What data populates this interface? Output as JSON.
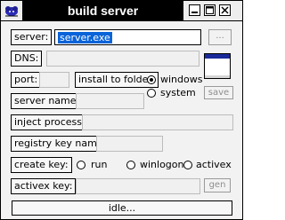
{
  "window": {
    "title": "build server"
  },
  "fields": {
    "server_label": "server:",
    "server_value": "server.exe",
    "browse_label": "...",
    "dns_label": "DNS:",
    "port_label": "port:",
    "install_label": "install to folder:",
    "install_options": [
      "windows",
      "system"
    ],
    "install_selected": "windows",
    "save_label": "save",
    "server_name_label": "server name:",
    "inject_label": "inject process:",
    "registry_label": "registry key name:",
    "create_key_label": "create key:",
    "create_key_options": [
      "run",
      "winlogon",
      "activex"
    ],
    "activex_label": "activex key:",
    "gen_label": "gen"
  },
  "status": {
    "text": "idle..."
  },
  "icons": {
    "app": "rat-mascot-icon",
    "preview": "window-preview-icon"
  }
}
